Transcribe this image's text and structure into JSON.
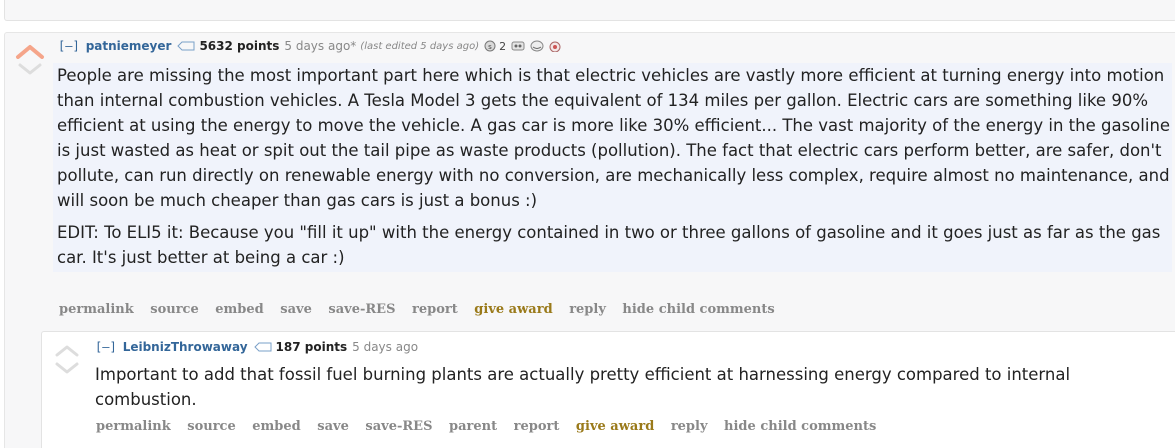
{
  "colors": {
    "link": "#336699",
    "award": "#9a7a1a",
    "meta": "#888888",
    "highlight": "#f0f3fb"
  },
  "parent": {
    "expand": "[–]",
    "author": "patniemeyer",
    "score": "5632 points",
    "time": "5 days ago*",
    "edited": "(last edited 5 days ago)",
    "award_count": "2",
    "body": [
      "People are missing the most important part here which is that electric vehicles are vastly more efficient at turning energy into motion than internal combustion vehicles. A Tesla Model 3 gets the equivalent of 134 miles per gallon. Electric cars are something like 90% efficient at using the energy to move the vehicle. A gas car is more like 30% efficient... The vast majority of the energy in the gasoline is just wasted as heat or spit out the tail pipe as waste products (pollution). The fact that electric cars perform better, are safer, don't pollute, can run directly on renewable energy with no conversion, are mechanically less complex, require almost no maintenance, and will soon be much cheaper than gas cars is just a bonus :)",
      "EDIT: To ELI5 it: Because you \"fill it up\" with the energy contained in two or three gallons of gasoline and it goes just as far as the gas car. It's just better at being a car :)"
    ],
    "actions": {
      "permalink": "permalink",
      "source": "source",
      "embed": "embed",
      "save": "save",
      "save_res": "save-RES",
      "report": "report",
      "give_award": "give award",
      "reply": "reply",
      "hide_child": "hide child comments"
    }
  },
  "child": {
    "expand": "[–]",
    "author": "LeibnizThrowaway",
    "score": "187 points",
    "time": "5 days ago",
    "body": "Important to add that fossil fuel burning plants are actually pretty efficient at harnessing energy compared to internal combustion.",
    "actions": {
      "permalink": "permalink",
      "source": "source",
      "embed": "embed",
      "save": "save",
      "save_res": "save-RES",
      "parent": "parent",
      "report": "report",
      "give_award": "give award",
      "reply": "reply",
      "hide_child": "hide child comments"
    }
  }
}
